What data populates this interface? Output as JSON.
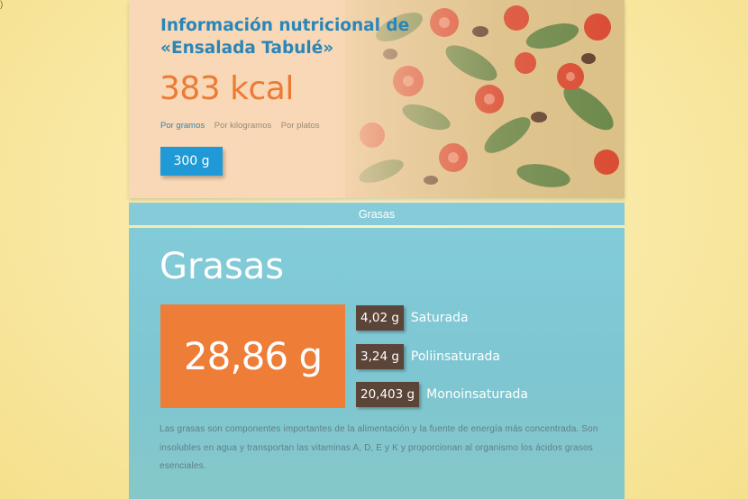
{
  "hero": {
    "title": "Información nutricional de «Ensalada Tabulé»",
    "kcal": "383 kcal",
    "tabs": [
      {
        "label": "Por gramos",
        "active": true
      },
      {
        "label": "Por kilogramos",
        "active": false
      },
      {
        "label": "Por platos",
        "active": false
      }
    ],
    "portion": "300 g"
  },
  "section_bar": {
    "label": "Grasas"
  },
  "fats": {
    "title": "Grasas",
    "total": "28,86 g",
    "items": [
      {
        "value": "4,02 g",
        "label": "Saturada"
      },
      {
        "value": "3,24 g",
        "label": "Poliinsaturada"
      },
      {
        "value": "20,403 g",
        "label": "Monoinsaturada"
      }
    ],
    "description": "Las grasas son componentes importantes de la alimentación y la fuente de energía más concentrada. Son insolubles en agua y transportan las vitaminas A, D, E y K y proporcionan al organismo los ácidos grasos esenciales."
  },
  "colors": {
    "accent_orange": "#ee7d38",
    "accent_blue": "#1f9ad6",
    "title_blue": "#2a86b8",
    "panel_teal": "#82cbd9",
    "value_brown": "#5b4438"
  }
}
